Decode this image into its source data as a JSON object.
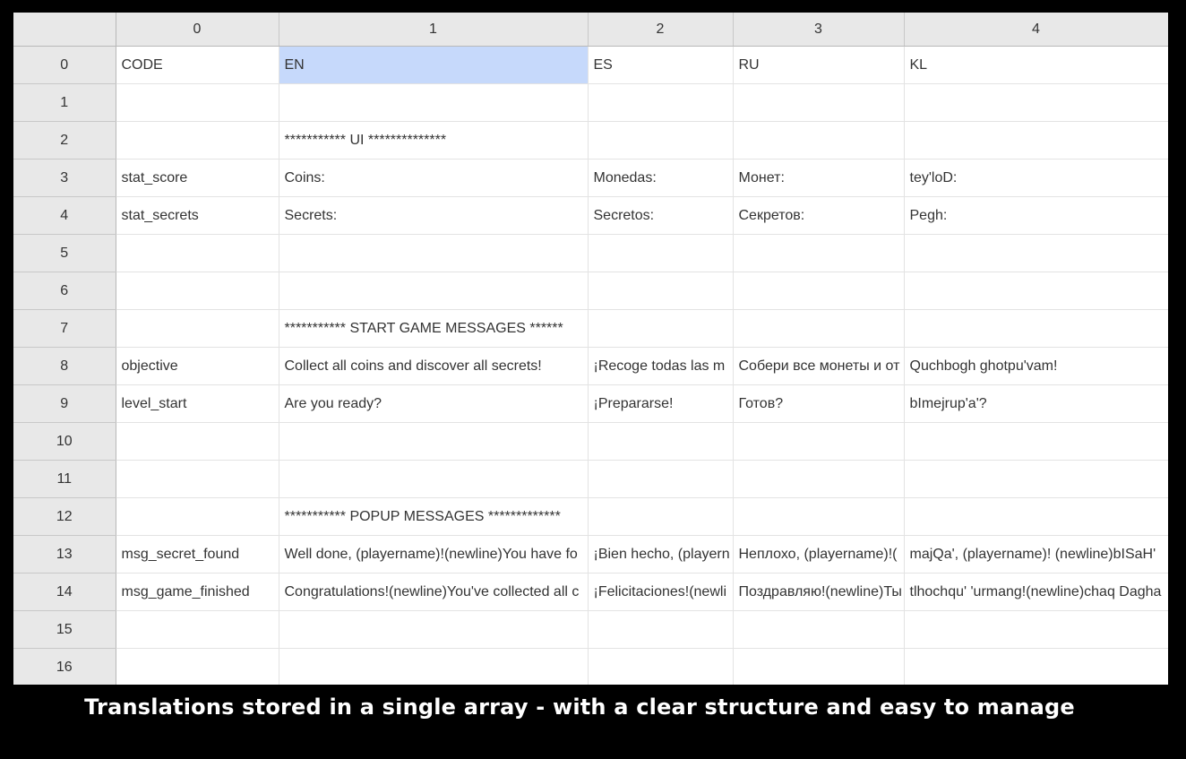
{
  "sheet": {
    "column_headers": [
      "0",
      "1",
      "2",
      "3",
      "4"
    ],
    "selected_cell": {
      "row": 0,
      "col": 1
    },
    "rows": [
      {
        "header": "0",
        "cells": [
          "CODE",
          "EN",
          "ES",
          "RU",
          "KL"
        ]
      },
      {
        "header": "1",
        "cells": [
          "",
          "",
          "",
          "",
          ""
        ]
      },
      {
        "header": "2",
        "cells": [
          "",
          "***********   UI   **************",
          "",
          "",
          ""
        ]
      },
      {
        "header": "3",
        "cells": [
          "stat_score",
          "Coins:",
          "Monedas:",
          "Монет:",
          "tey'loD:"
        ]
      },
      {
        "header": "4",
        "cells": [
          "stat_secrets",
          "Secrets:",
          "Secretos:",
          "Секретов:",
          "Pegh:"
        ]
      },
      {
        "header": "5",
        "cells": [
          "",
          "",
          "",
          "",
          ""
        ]
      },
      {
        "header": "6",
        "cells": [
          "",
          "",
          "",
          "",
          ""
        ]
      },
      {
        "header": "7",
        "cells": [
          "",
          "***********   START GAME MESSAGES   ******",
          "",
          "",
          ""
        ]
      },
      {
        "header": "8",
        "cells": [
          "objective",
          "Collect all coins and discover all secrets!",
          "¡Recoge todas las m",
          "Собери все монеты и от",
          "Quchbogh ghotpu'vam!"
        ]
      },
      {
        "header": "9",
        "cells": [
          "level_start",
          "Are you ready?",
          "¡Prepararse!",
          "Готов?",
          "bImejrup'a'?"
        ]
      },
      {
        "header": "10",
        "cells": [
          "",
          "",
          "",
          "",
          ""
        ]
      },
      {
        "header": "11",
        "cells": [
          "",
          "",
          "",
          "",
          ""
        ]
      },
      {
        "header": "12",
        "cells": [
          "",
          "***********    POPUP MESSAGES   *************",
          "",
          "",
          ""
        ]
      },
      {
        "header": "13",
        "cells": [
          "msg_secret_found",
          "Well done, (playername)!(newline)You have fo",
          "¡Bien hecho, (playern",
          "Неплохо, (playername)!(",
          "majQa', (playername)! (newline)bISaH'"
        ]
      },
      {
        "header": "14",
        "cells": [
          "msg_game_finished",
          "Congratulations!(newline)You've collected all c",
          "¡Felicitaciones!(newli",
          "Поздравляю!(newline)Ты",
          "tlhochqu' 'urmang!(newline)chaq Dagha"
        ]
      },
      {
        "header": "15",
        "cells": [
          "",
          "",
          "",
          "",
          ""
        ]
      },
      {
        "header": "16",
        "cells": [
          "",
          "",
          "",
          "",
          ""
        ]
      }
    ]
  },
  "caption": "Translations stored in a single array - with a clear structure and easy to manage"
}
